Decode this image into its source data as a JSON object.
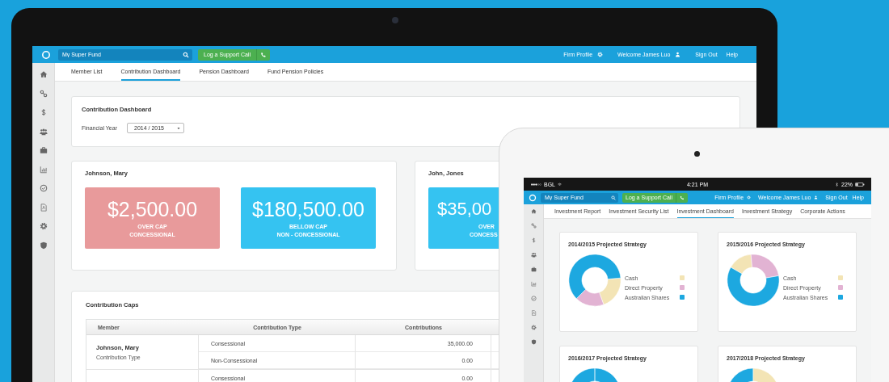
{
  "laptop": {
    "topbar": {
      "search": {
        "value": "My Super Fund"
      },
      "support_button": "Log a Support Call",
      "firm_profile": "Firm Profile",
      "welcome": "Welcome James Luo",
      "sign_out": "Sign Out",
      "help": "Help"
    },
    "tabs": [
      {
        "label": "Member List",
        "selected": false
      },
      {
        "label": "Contribution Dashboard",
        "selected": true
      },
      {
        "label": "Pension Dashboard",
        "selected": false
      },
      {
        "label": "Fund Pension Policies",
        "selected": false
      }
    ],
    "dashboard_card": {
      "title": "Contribution Dashboard",
      "financial_year": {
        "label": "Financial Year",
        "value": "2014 / 2015"
      }
    },
    "members": [
      {
        "name": "Johnson, Mary",
        "stats": [
          {
            "amount": "$2,500.00",
            "lines": [
              "OVER CAP",
              "CONCESSIONAL"
            ],
            "color": "#e89a9b"
          },
          {
            "amount": "$180,500.00",
            "lines": [
              "BELLOW CAP",
              "NON - CONCESSIONAL"
            ],
            "color": "#35c3f1"
          }
        ]
      },
      {
        "name": "John, Jones",
        "stats": [
          {
            "amount": "$35,00",
            "lines": [
              "OVER",
              "CONCESS"
            ],
            "color": "#35c3f1"
          }
        ]
      }
    ],
    "caps": {
      "title": "Contribution Caps",
      "columns": [
        "Member",
        "Contribution Type",
        "Contributions"
      ],
      "groups": [
        {
          "member": "Johnson, Mary",
          "subtitle": "Contribution Type",
          "rows": [
            {
              "type": "Consessional",
              "contributions": "35,000.00"
            },
            {
              "type": "Non-Consessional",
              "contributions": "0.00"
            }
          ]
        },
        {
          "rows": [
            {
              "type": "Consessional",
              "contributions": "0.00"
            }
          ]
        }
      ]
    }
  },
  "tablet": {
    "status_bar": {
      "carrier": "BGL",
      "time": "4:21 PM",
      "battery": "22%"
    },
    "topbar": {
      "search": {
        "value": "My Super Fund"
      },
      "support_button": "Log a Support Call",
      "firm_profile": "Firm Profile",
      "welcome": "Welcome James Luo",
      "sign_out": "Sign Out",
      "help": "Help"
    },
    "tabs": [
      {
        "label": "Investment Report",
        "selected": false
      },
      {
        "label": "Investment Security List",
        "selected": false
      },
      {
        "label": "Investment Dashboard",
        "selected": true
      },
      {
        "label": "Investment Strategy",
        "selected": false
      },
      {
        "label": "Corporate Actions",
        "selected": false
      }
    ],
    "charts": [
      {
        "title": "2014/2015 Projected Strategy",
        "legend": [
          {
            "label": "Cash",
            "color": "#f3e4b5"
          },
          {
            "label": "Direct Property",
            "color": "#e2b3d3"
          },
          {
            "label": "Australian Shares",
            "color": "#1da8e0"
          }
        ]
      },
      {
        "title": "2015/2016 Projected Strategy",
        "legend": [
          {
            "label": "Cash",
            "color": "#f3e4b5"
          },
          {
            "label": "Direct Property",
            "color": "#e2b3d3"
          },
          {
            "label": "Australian Shares",
            "color": "#1da8e0"
          }
        ]
      },
      {
        "title": "2016/2017 Projected Strategy"
      },
      {
        "title": "2017/2018 Projected Strategy"
      }
    ]
  }
}
